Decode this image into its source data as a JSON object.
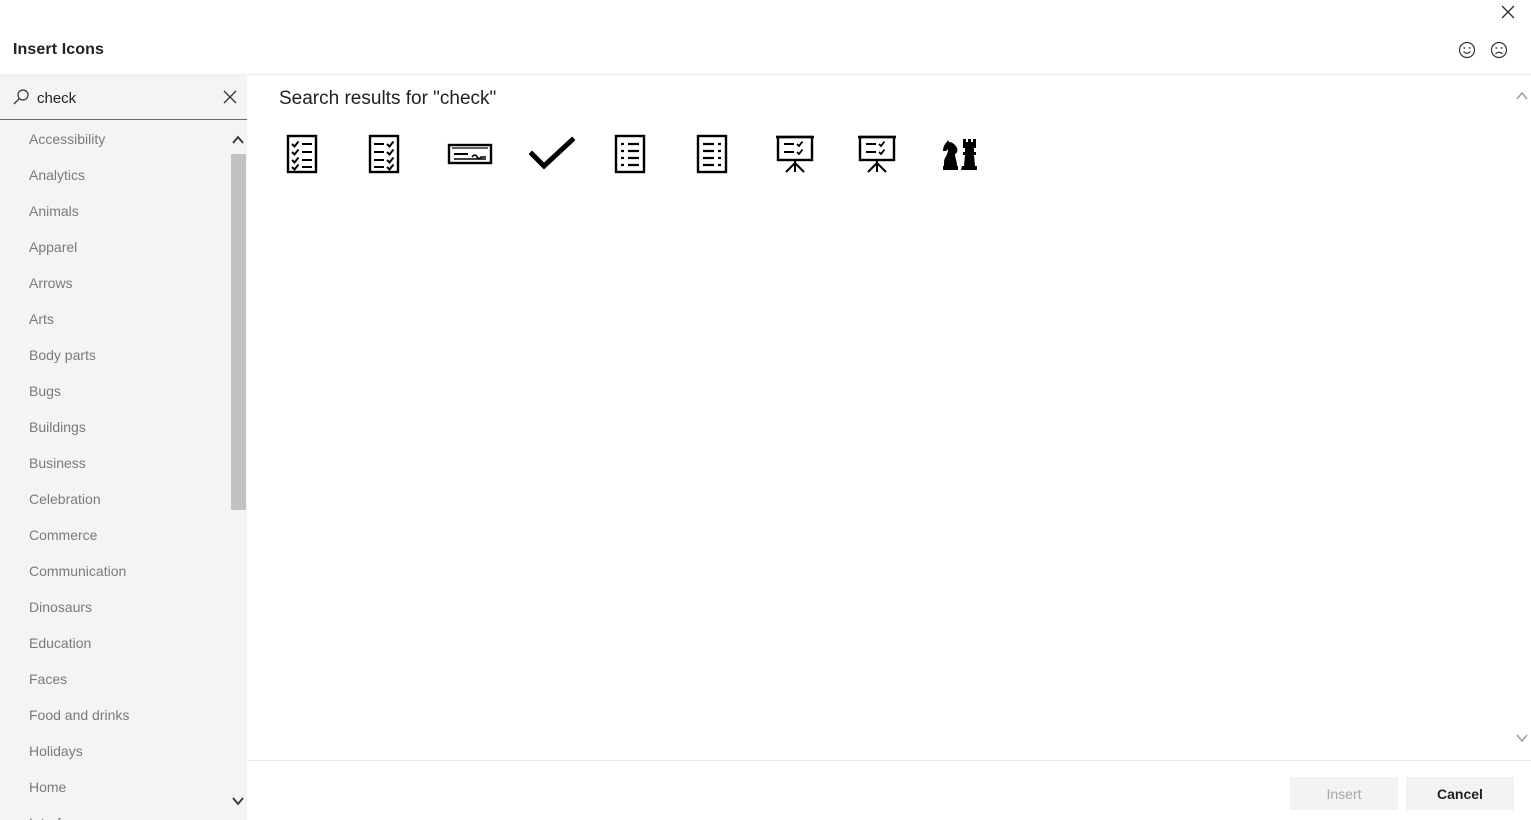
{
  "dialog": {
    "title": "Insert Icons"
  },
  "search": {
    "value": "check",
    "placeholder": ""
  },
  "categories": [
    "Accessibility",
    "Analytics",
    "Animals",
    "Apparel",
    "Arrows",
    "Arts",
    "Body parts",
    "Bugs",
    "Buildings",
    "Business",
    "Celebration",
    "Commerce",
    "Communication",
    "Dinosaurs",
    "Education",
    "Faces",
    "Food and drinks",
    "Holidays",
    "Home",
    "Interface"
  ],
  "results": {
    "title": "Search results for \"check\"",
    "icons": [
      "checklist-icon",
      "checklist-icon",
      "bank-check-icon",
      "checkmark-icon",
      "list-icon",
      "list-icon",
      "presentation-checklist-icon",
      "presentation-checklist-icon",
      "chess-pieces-icon"
    ]
  },
  "footer": {
    "insert_label": "Insert",
    "cancel_label": "Cancel"
  },
  "colors": {
    "sidebar_bg": "#f4f4f4",
    "category_text": "#7a7a7a",
    "scroll_thumb": "#c2c2c2",
    "button_bg": "#f3f3f3",
    "disabled_text": "#a6a6a6"
  }
}
